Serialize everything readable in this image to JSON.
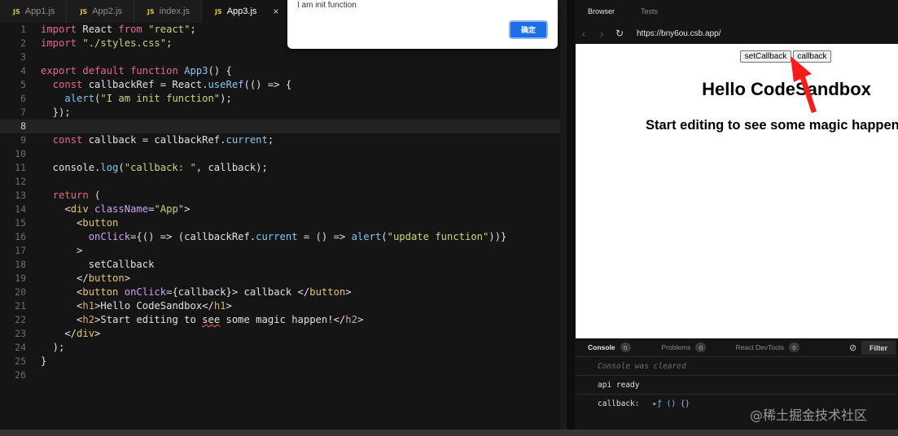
{
  "editor": {
    "tabs": [
      {
        "icon": "JS",
        "label": "App1.js"
      },
      {
        "icon": "JS",
        "label": "App2.js"
      },
      {
        "icon": "JS",
        "label": "index.js"
      },
      {
        "icon": "JS",
        "label": "App3.js",
        "close": "×"
      }
    ],
    "line_numbers": [
      "1",
      "2",
      "3",
      "4",
      "5",
      "6",
      "7",
      "8",
      "9",
      "10",
      "11",
      "12",
      "13",
      "14",
      "15",
      "16",
      "17",
      "18",
      "19",
      "20",
      "21",
      "22",
      "23",
      "24",
      "25",
      "26"
    ],
    "code": [
      [
        [
          "kw",
          "import"
        ],
        [
          "pl",
          " React "
        ],
        [
          "kw",
          "from"
        ],
        [
          "pl",
          " "
        ],
        [
          "str",
          "\"react\""
        ],
        [
          "pl",
          ";"
        ]
      ],
      [
        [
          "kw",
          "import"
        ],
        [
          "pl",
          " "
        ],
        [
          "str",
          "\"./styles.css\""
        ],
        [
          "pl",
          ";"
        ]
      ],
      [],
      [
        [
          "kw",
          "export"
        ],
        [
          "pl",
          " "
        ],
        [
          "kw",
          "default"
        ],
        [
          "pl",
          " "
        ],
        [
          "kw",
          "function"
        ],
        [
          "pl",
          " "
        ],
        [
          "fn",
          "App3"
        ],
        [
          "pl",
          "() {"
        ]
      ],
      [
        [
          "pl",
          "  "
        ],
        [
          "kw",
          "const"
        ],
        [
          "pl",
          " callbackRef = React."
        ],
        [
          "fn",
          "useRef"
        ],
        [
          "pl",
          "(() => {"
        ]
      ],
      [
        [
          "pl",
          "    "
        ],
        [
          "fn",
          "alert"
        ],
        [
          "pl",
          "("
        ],
        [
          "str",
          "\"I am init function\""
        ],
        [
          "pl",
          ");"
        ]
      ],
      [
        [
          "pl",
          "  });"
        ]
      ],
      [],
      [
        [
          "pl",
          "  "
        ],
        [
          "kw",
          "const"
        ],
        [
          "pl",
          " callback = callbackRef."
        ],
        [
          "fn",
          "current"
        ],
        [
          "pl",
          ";"
        ]
      ],
      [],
      [
        [
          "pl",
          "  console."
        ],
        [
          "fn",
          "log"
        ],
        [
          "pl",
          "("
        ],
        [
          "str",
          "\"callback: \""
        ],
        [
          "pl",
          ", callback);"
        ]
      ],
      [],
      [
        [
          "pl",
          "  "
        ],
        [
          "kw",
          "return"
        ],
        [
          "pl",
          " ("
        ]
      ],
      [
        [
          "pl",
          "    <"
        ],
        [
          "tag",
          "div"
        ],
        [
          "pl",
          " "
        ],
        [
          "attr",
          "className"
        ],
        [
          "pl",
          "="
        ],
        [
          "str",
          "\"App\""
        ],
        [
          "pl",
          ">"
        ]
      ],
      [
        [
          "pl",
          "      <"
        ],
        [
          "tag",
          "button"
        ]
      ],
      [
        [
          "pl",
          "        "
        ],
        [
          "attr",
          "onClick"
        ],
        [
          "pl",
          "={() => (callbackRef."
        ],
        [
          "fn",
          "current"
        ],
        [
          "pl",
          " = () => "
        ],
        [
          "fn",
          "alert"
        ],
        [
          "pl",
          "("
        ],
        [
          "str",
          "\"update function\""
        ],
        [
          "pl",
          "))}"
        ]
      ],
      [
        [
          "pl",
          "      >"
        ]
      ],
      [
        [
          "pl",
          "        setCallback"
        ]
      ],
      [
        [
          "pl",
          "      </"
        ],
        [
          "tag",
          "button"
        ],
        [
          "pl",
          ">"
        ]
      ],
      [
        [
          "pl",
          "      <"
        ],
        [
          "tag",
          "button"
        ],
        [
          "pl",
          " "
        ],
        [
          "attr",
          "onClick"
        ],
        [
          "pl",
          "={callback}> callback </"
        ],
        [
          "tag",
          "button"
        ],
        [
          "pl",
          ">"
        ]
      ],
      [
        [
          "pl",
          "      <"
        ],
        [
          "jsx",
          "h1"
        ],
        [
          "pl",
          ">Hello CodeSandbox</"
        ],
        [
          "jsx",
          "h1"
        ],
        [
          "pl",
          ">"
        ]
      ],
      [
        [
          "pl",
          "      <"
        ],
        [
          "jsx",
          "h2"
        ],
        [
          "pl",
          ">Start editing to "
        ],
        [
          "squig",
          "see"
        ],
        [
          "pl",
          " some magic happen!</"
        ],
        [
          "jsx",
          "h2"
        ],
        [
          "pl",
          ">"
        ]
      ],
      [
        [
          "pl",
          "    </"
        ],
        [
          "tag",
          "div"
        ],
        [
          "pl",
          ">"
        ]
      ],
      [
        [
          "pl",
          "  );"
        ]
      ],
      [
        [
          "pl",
          "}"
        ]
      ],
      []
    ],
    "current_line": 8
  },
  "alert": {
    "message": "I am init function",
    "ok_label": "确定"
  },
  "browser": {
    "tabs": [
      "Browser",
      "Tests"
    ],
    "nav": {
      "back": "‹",
      "forward": "›",
      "reload": "↻"
    },
    "url": "https://bny6ou.csb.app/",
    "preview": {
      "buttons": [
        "setCallback",
        "callback"
      ],
      "h1": "Hello CodeSandbox",
      "h2": "Start editing to see some magic happen!"
    },
    "annotation_color": "#ff1a1a"
  },
  "console": {
    "tabs": [
      {
        "label": "Console",
        "count": "0"
      },
      {
        "label": "Problems",
        "count": "0"
      },
      {
        "label": "React DevTools",
        "count": "0"
      }
    ],
    "clear_icon": "⊘",
    "filter_label": "Filter",
    "rows": [
      "Console was cleared",
      "api ready",
      "callback:"
    ],
    "callback_value": "▸ƒ () {}"
  },
  "watermark": "@稀土掘金技术社区"
}
